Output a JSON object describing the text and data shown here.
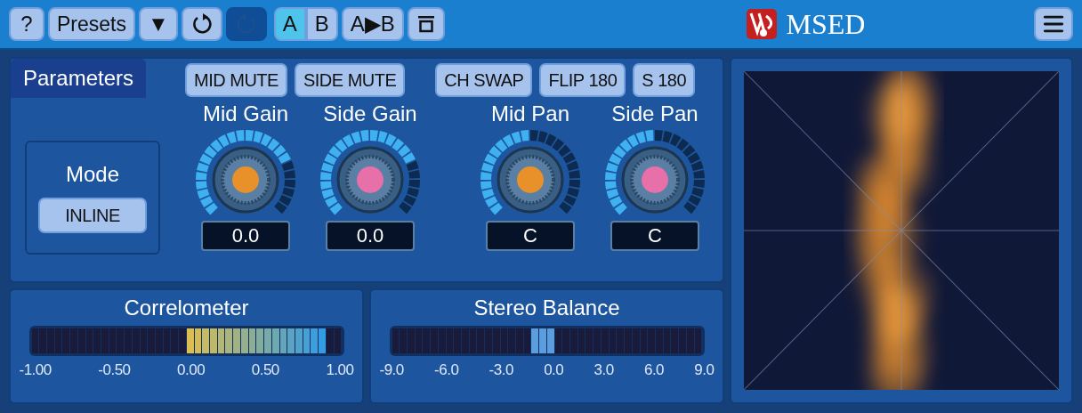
{
  "toolbar": {
    "help": "?",
    "presets": "Presets",
    "dropdown": "▼",
    "undo": {
      "disabled": false
    },
    "redo": {
      "disabled": true
    },
    "ab": [
      {
        "label": "A",
        "selected": true
      },
      {
        "label": "B",
        "selected": false
      }
    ],
    "copy": "A▶B"
  },
  "title": "MSED",
  "tabs": [
    {
      "label": "Parameters",
      "selected": true
    }
  ],
  "mode": {
    "label": "Mode",
    "value": "INLINE"
  },
  "toggles": [
    {
      "label": "MID MUTE",
      "on": false
    },
    {
      "label": "SIDE MUTE",
      "on": false
    },
    {
      "label": "CH SWAP",
      "on": false
    },
    {
      "label": "FLIP 180",
      "on": false
    },
    {
      "label": "S 180",
      "on": false
    }
  ],
  "knobs": [
    {
      "label": "Mid Gain",
      "value": "0.0",
      "color": "#e8902a"
    },
    {
      "label": "Side Gain",
      "value": "0.0",
      "color": "#e870a8"
    },
    {
      "label": "Mid Pan",
      "value": "C",
      "color": "#e8902a"
    },
    {
      "label": "Side Pan",
      "value": "C",
      "color": "#e870a8"
    }
  ],
  "meters": [
    {
      "kind": "correlation",
      "title": "Correlometer",
      "ticks": [
        "-1.00",
        "-0.50",
        "0.00",
        "0.50",
        "1.00"
      ]
    },
    {
      "kind": "balance",
      "title": "Stereo Balance",
      "ticks": [
        "-9.0",
        "-6.0",
        "-3.0",
        "0.0",
        "3.0",
        "6.0",
        "9.0"
      ]
    }
  ]
}
